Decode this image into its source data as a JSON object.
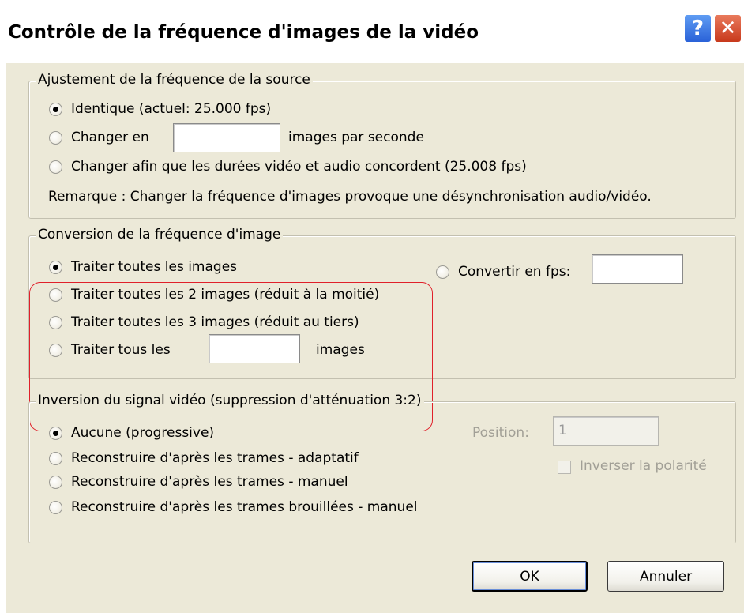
{
  "window": {
    "title": "Contrôle de la fréquence d'images de la vidéo",
    "help_glyph": "?",
    "close_glyph": "✕"
  },
  "source_group": {
    "legend": "Ajustement de la fréquence de la source",
    "options": [
      {
        "label": "Identique (actuel: 25.000 fps)",
        "checked": true
      },
      {
        "label": "Changer en",
        "checked": false
      },
      {
        "label": "Changer afin que les durées vidéo et audio concordent  (25.008 fps)",
        "checked": false
      }
    ],
    "fps_field_value": "",
    "fps_suffix": "images par seconde",
    "note": "Remarque : Changer la fréquence d'images provoque une désynchronisation audio/vidéo."
  },
  "conversion_group": {
    "legend": "Conversion de la fréquence d'image",
    "options": [
      {
        "label": "Traiter toutes les images",
        "checked": true
      },
      {
        "label": "Traiter toutes les 2 images (réduit à la moitié)",
        "checked": false
      },
      {
        "label": "Traiter toutes les 3 images (réduit au tiers)",
        "checked": false
      },
      {
        "label": "Traiter tous les",
        "checked": false
      }
    ],
    "every_n_value": "",
    "every_n_suffix": "images",
    "convert_option": {
      "label": "Convertir en fps:",
      "checked": false
    },
    "convert_value": ""
  },
  "ivtc_group": {
    "legend": "Inversion du signal vidéo (suppression d'atténuation 3:2)",
    "options": [
      {
        "label": "Aucune (progressive)",
        "checked": true
      },
      {
        "label": "Reconstruire d'après les trames - adaptatif",
        "checked": false
      },
      {
        "label": "Reconstruire d'après les trames - manuel",
        "checked": false
      },
      {
        "label": "Reconstruire d'après les trames brouillées - manuel",
        "checked": false
      }
    ],
    "position_label": "Position:",
    "position_value": "1",
    "invert_label": "Inverser la polarité"
  },
  "buttons": {
    "ok": "OK",
    "cancel": "Annuler"
  },
  "colors": {
    "dialog_bg": "#ECE9D8",
    "highlight": "#e0202a"
  }
}
